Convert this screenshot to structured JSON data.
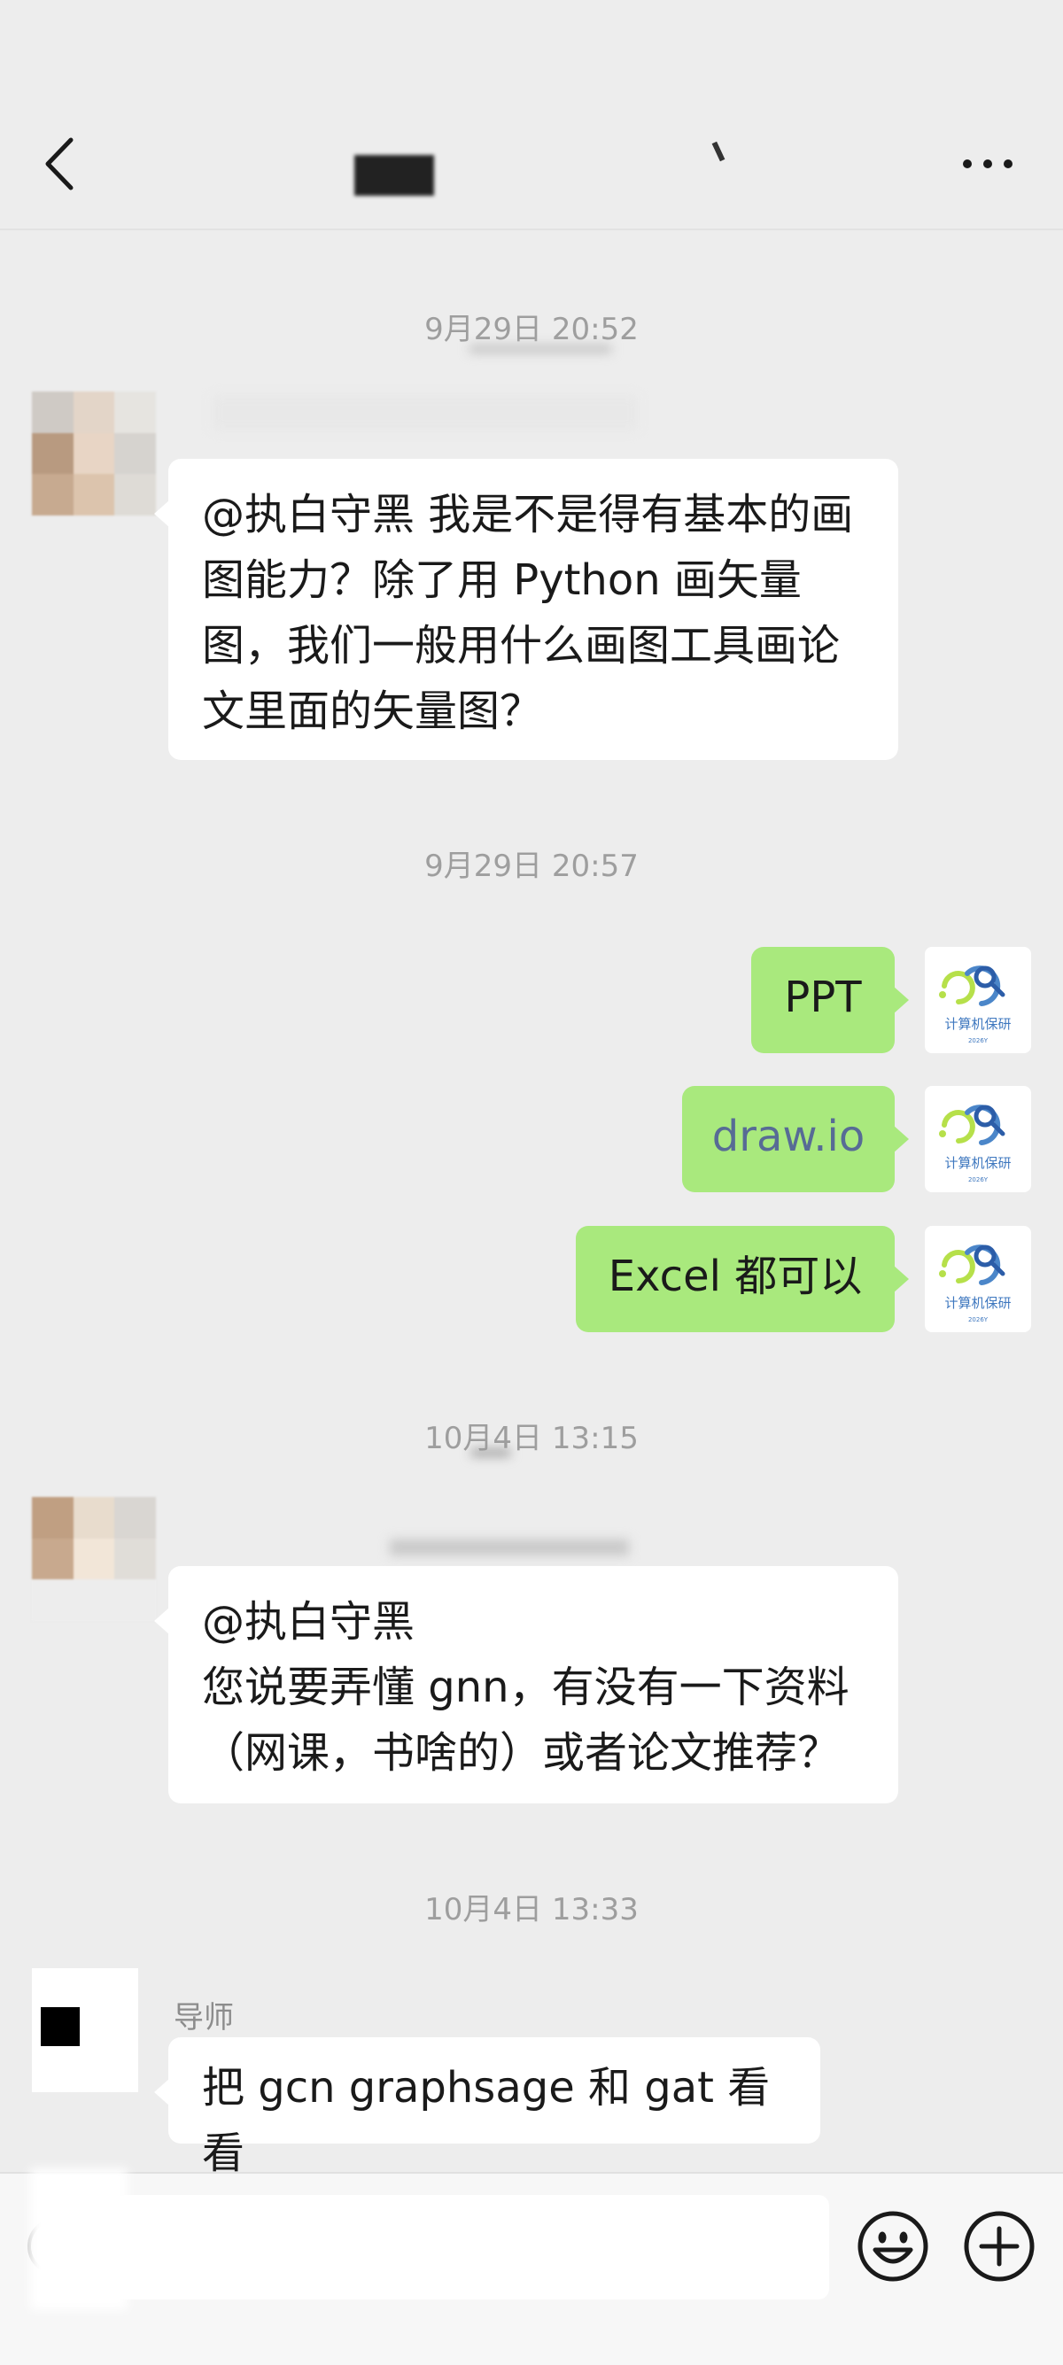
{
  "header": {
    "back_icon": "chevron-left-icon",
    "more_icon": "more-horizontal-icon"
  },
  "messages": {
    "ts1": "9月29日 20:52",
    "msg1": "@执白守黑  我是不是得有基本的画图能力？除了用 Python 画矢量图，我们一般用什么画图工具画论文里面的矢量图？",
    "ts2": "9月29日 20:57",
    "reply1": "PPT",
    "reply2": "draw.io",
    "reply3": "Excel 都可以",
    "ts3": "10月4日 13:15",
    "msg2_line1": "@执白守黑",
    "msg2_line2": "您说要弄懂 gnn，有没有一下资料（网课，书啥的）或者论文推荐？",
    "ts4": "10月4日 13:33",
    "sender3": "导师",
    "msg3": "把 gcn graphsage 和 gat 看看"
  },
  "logo": {
    "text": "计算机保研",
    "sub": "2026Y"
  },
  "input": {
    "value": "",
    "emoji_icon": "smiley-icon",
    "plus_icon": "plus-circle-icon"
  },
  "colors": {
    "background": "#ededed",
    "my_bubble": "#a9e97d",
    "their_bubble": "#ffffff",
    "link": "#576b95"
  }
}
